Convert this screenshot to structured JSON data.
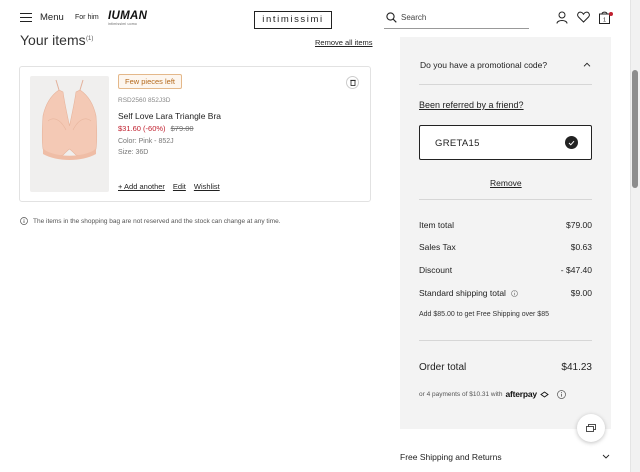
{
  "header": {
    "menu_label": "Menu",
    "for_him_label": "For him",
    "iuman_logo": "IUMAN",
    "iuman_sub": "intimissimi uomo",
    "brand_logo": "intimissimi",
    "search_placeholder": "Search",
    "icons": [
      "menu-icon",
      "search-icon",
      "user-icon",
      "heart-icon",
      "bag-icon"
    ],
    "cart_dot_color": "#c0202f"
  },
  "bag": {
    "title": "Your items",
    "count": "(1)",
    "remove_all_label": "Remove all items",
    "item": {
      "badge": "Few pieces left",
      "sku": "RSD2560 852J3D",
      "name": "Self Love Lara Triangle Bra",
      "price_now": "$31.60 (-60%)",
      "price_old": "$79.00",
      "color": "Color: Pink - 852J",
      "size": "Size: 36D",
      "add_another": "+ Add another",
      "edit": "Edit",
      "wishlist": "Wishlist",
      "image_color": "#f4c9b5"
    },
    "notice": "The items in the shopping bag are not reserved and the stock can change at any time."
  },
  "summary": {
    "promo_question": "Do you have a promotional code?",
    "referred_label": "Been referred by a friend?",
    "promo_code": "GRETA15",
    "remove_label": "Remove",
    "item_total_label": "Item total",
    "item_total_value": "$79.00",
    "sales_tax_label": "Sales Tax",
    "sales_tax_value": "$0.63",
    "discount_label": "Discount",
    "discount_value": "- $47.40",
    "shipping_label": "Standard shipping total",
    "shipping_value": "$9.00",
    "free_shipping_note": "Add $85.00 to get Free Shipping over $85",
    "order_total_label": "Order total",
    "order_total_value": "$41.23",
    "afterpay_text": "or 4 payments of $10.31 with",
    "afterpay_logo": "afterpay"
  },
  "footer": {
    "free_shipping_returns": "Free Shipping and Returns"
  }
}
